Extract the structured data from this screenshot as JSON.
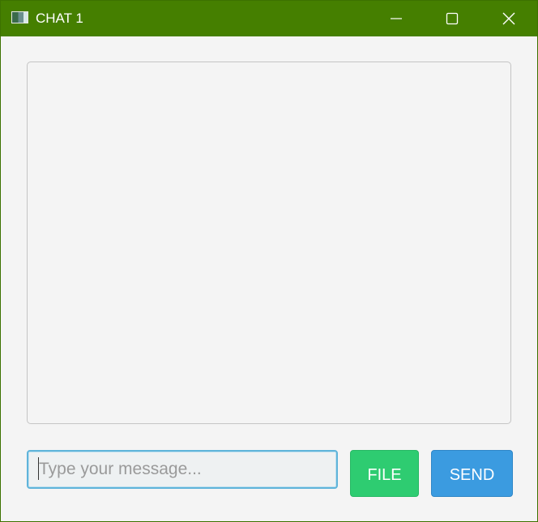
{
  "window": {
    "title": "CHAT 1",
    "icons": {
      "app": "app-window-icon",
      "minimize": "minimize-icon",
      "maximize": "maximize-icon",
      "close": "close-icon"
    },
    "colors": {
      "titlebar": "#457f00",
      "background": "#f4f4f4"
    }
  },
  "composer": {
    "input_value": "",
    "placeholder": "Type your message...",
    "file_label": "FILE",
    "send_label": "SEND",
    "colors": {
      "file_button": "#2ecc71",
      "send_button": "#3b9be0"
    }
  }
}
